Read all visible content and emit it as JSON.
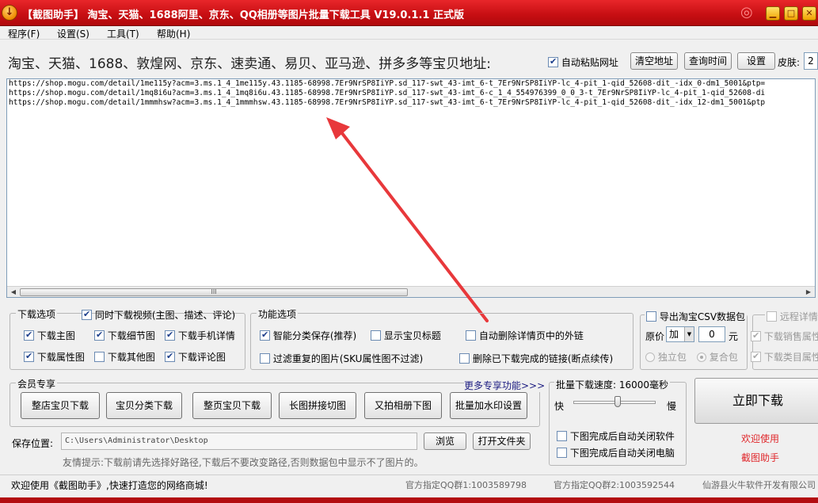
{
  "window": {
    "title": "【截图助手】 淘宝、天猫、1688阿里、京东、QQ相册等图片批量下载工具 V19.0.1.1 正式版",
    "app_icon": "download-arrow-icon",
    "minimize": "▁",
    "maximize": "□",
    "close": "✕"
  },
  "menu": [
    "程序(F)",
    "设置(S)",
    "工具(T)",
    "帮助(H)"
  ],
  "url_bar": {
    "label": "淘宝、天猫、1688、敦煌网、京东、速卖通、易贝、亚马逊、拼多多等宝贝地址:",
    "auto_paste_label": "自动粘贴网址",
    "auto_paste_checked": true,
    "clear_button": "清空地址",
    "query_time_button": "查询时间",
    "settings_button": "设置",
    "skin_label": "皮肤:",
    "skin_value": "2"
  },
  "urls": [
    "https://shop.mogu.com/detail/1me115y?acm=3.ms.1_4_1me115y.43.1185-68998.7Er9NrSP8IiYP.sd_117-swt_43-imt_6-t_7Er9NrSP8IiYP-lc_4-pit_1-qid_52608-dit_-idx_0-dm1_5001&ptp=",
    "https://shop.mogu.com/detail/1mq8i6u?acm=3.ms.1_4_1mq8i6u.43.1185-68998.7Er9NrSP8IiYP.sd_117-swt_43-imt_6-c_1_4_554976399_0_0_3-t_7Er9NrSP8IiYP-lc_4-pit_1-qid_52608-di",
    "https://shop.mogu.com/detail/1mmmhsw?acm=3.ms.1_4_1mmmhsw.43.1185-68998.7Er9NrSP8IiYP.sd_117-swt_43-imt_6-t_7Er9NrSP8IiYP-lc_4-pit_1-qid_52608-dit_-idx_12-dm1_5001&ptp"
  ],
  "scroll_grip": "III",
  "download_options": {
    "title": "下载选项",
    "video_label": "同时下载视频(主图、描述、评论)",
    "video_checked": true,
    "items": [
      {
        "label": "下载主图",
        "checked": true
      },
      {
        "label": "下载细节图",
        "checked": true
      },
      {
        "label": "下载手机详情",
        "checked": true
      },
      {
        "label": "下载属性图",
        "checked": true
      },
      {
        "label": "下载其他图",
        "checked": false
      },
      {
        "label": "下载评论图",
        "checked": true
      }
    ]
  },
  "function_options": {
    "title": "功能选项",
    "items": [
      {
        "label": "智能分类保存(推荐)",
        "checked": true
      },
      {
        "label": "显示宝贝标题",
        "checked": false
      },
      {
        "label": "自动删除详情页中的外链",
        "checked": false
      },
      {
        "label": "过滤重复的图片(SKU属性图不过滤)",
        "checked": false
      },
      {
        "label": "删除已下载完成的链接(断点续传)",
        "checked": false
      }
    ]
  },
  "csv": {
    "export_label": "导出淘宝CSV数据包",
    "price_label": "原价",
    "price_op": "加",
    "price_value": "0",
    "unit": "元",
    "radio_single": "独立包",
    "radio_combined": "复合包"
  },
  "remote": {
    "title": "远程详情",
    "sales_attr": "下载销售属性",
    "category_attr": "下载类目属性"
  },
  "member": {
    "title": "会员专享",
    "more_link": "更多专享功能>>>",
    "buttons": [
      "整店宝贝下载",
      "宝贝分类下载",
      "整页宝贝下载",
      "长图拼接切图",
      "又拍相册下图",
      "批量加水印设置"
    ]
  },
  "speed": {
    "title": "批量下载速度:",
    "value": "16000毫秒",
    "fast": "快",
    "slow": "慢",
    "level": 0.4,
    "close_app": "下图完成后自动关闭软件",
    "shutdown": "下图完成后自动关闭电脑"
  },
  "download_now": "立即下载",
  "welcome_line1": "欢迎使用",
  "welcome_line2": "截图助手",
  "save": {
    "label": "保存位置:",
    "path": "C:\\Users\\Administrator\\Desktop",
    "browse": "浏览",
    "open_folder": "打开文件夹",
    "tip": "友情提示:下载前请先选择好路径,下载后不要改变路径,否则数据包中显示不了图片的。"
  },
  "status_bar": {
    "welcome": "欢迎使用《截图助手》,快速打造您的网络商城!",
    "qq1": "官方指定QQ群1:1003589798",
    "qq2": "官方指定QQ群2:1003592544",
    "company": "仙游县火牛软件开发有限公司"
  },
  "colors": {
    "titlebar": "#c60e12",
    "accent_red": "#e0282c",
    "arrow": "#e8383b"
  }
}
